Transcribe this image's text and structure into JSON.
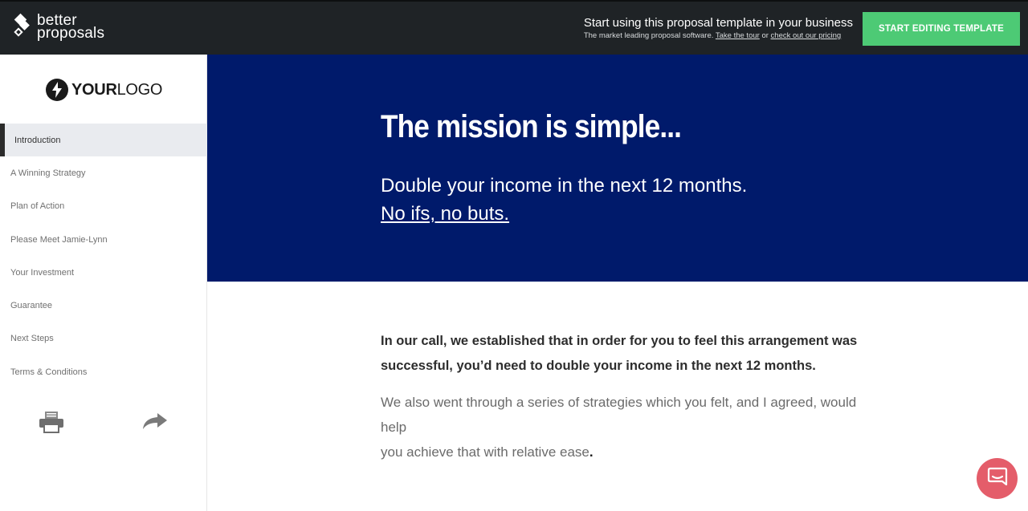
{
  "topbar": {
    "brand_line1": "better",
    "brand_line2": "proposals",
    "cta_title": "Start using this proposal template in your business",
    "cta_sub_prefix": "The market leading proposal software.",
    "tour_link": "Take the tour",
    "or_text": "or",
    "pricing_link": "check out our pricing",
    "start_button": "START EDITING TEMPLATE"
  },
  "sidebar": {
    "logo_bold": "YOUR",
    "logo_light": "LOGO",
    "items": [
      {
        "label": "Introduction"
      },
      {
        "label": "A Winning Strategy"
      },
      {
        "label": "Plan of Action"
      },
      {
        "label": "Please Meet Jamie-Lynn"
      },
      {
        "label": "Your Investment"
      },
      {
        "label": "Guarantee"
      },
      {
        "label": "Next Steps"
      },
      {
        "label": "Terms & Conditions"
      }
    ],
    "active_index": 0
  },
  "hero": {
    "title": "The mission is simple...",
    "line1": "Double your income in the next 12 months.",
    "line2": "No ifs, no buts."
  },
  "content": {
    "bold_para": "In our call, we established that in order for you to feel this arrangement was successful, you’d need to double your income in the next 12 months.",
    "body_para_line1": "We also went through a series of strategies which you felt, and I agreed, would help",
    "body_para_line2": "you achieve that with relative ease",
    "body_para_end": "."
  },
  "colors": {
    "topbar_bg": "#1f2326",
    "accent_green": "#4dca75",
    "hero_bg": "#001a6b",
    "chat_button": "#e45d6a"
  },
  "icons": {
    "brand": "better-proposals-logo-icon",
    "logo": "lightning-bolt-icon",
    "print": "printer-icon",
    "share": "share-arrow-icon",
    "chat": "chat-bubble-icon"
  }
}
